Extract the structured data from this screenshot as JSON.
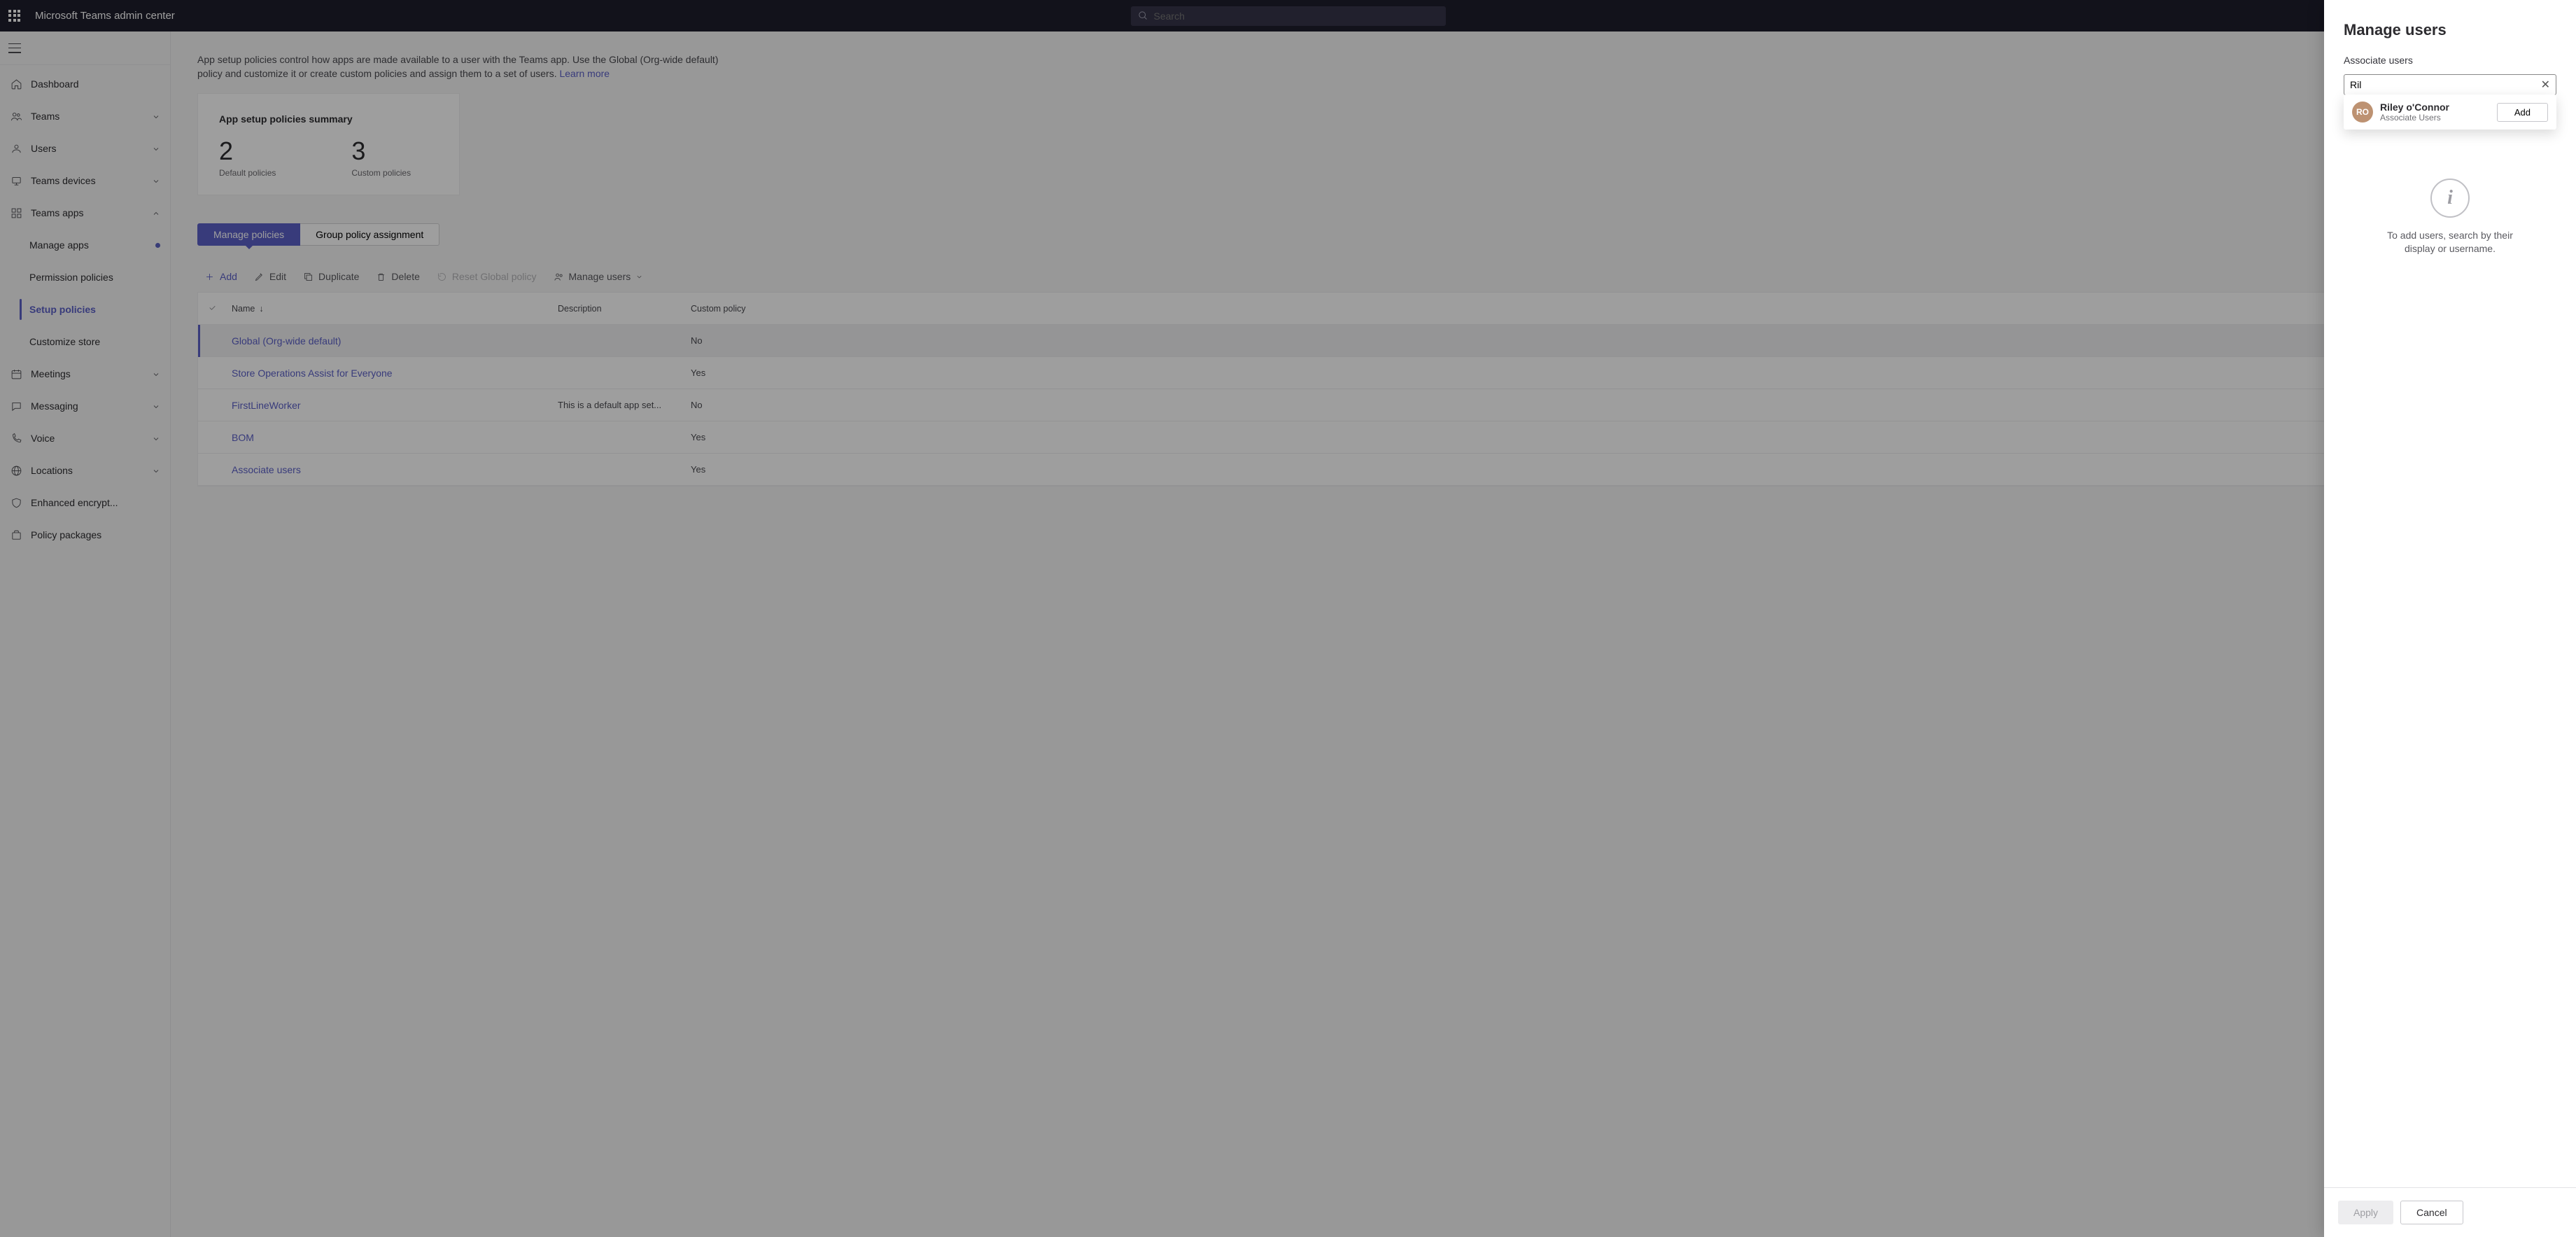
{
  "app_title": "Microsoft Teams admin center",
  "search_placeholder": "Search",
  "nav": {
    "dashboard": "Dashboard",
    "teams": "Teams",
    "users": "Users",
    "teams_devices": "Teams devices",
    "teams_apps": "Teams apps",
    "manage_apps": "Manage apps",
    "permission_policies": "Permission policies",
    "setup_policies": "Setup policies",
    "customize_store": "Customize store",
    "meetings": "Meetings",
    "messaging": "Messaging",
    "voice": "Voice",
    "locations": "Locations",
    "enhanced_encrypt": "Enhanced encrypt...",
    "policy_packages": "Policy packages"
  },
  "page": {
    "desc": "App setup policies control how apps are made available to a user with the Teams app. Use the Global (Org-wide default) policy and customize it or create custom policies and assign them to a set of users. ",
    "learn_more": "Learn more",
    "summary_title": "App setup policies summary",
    "default_count": "2",
    "default_label": "Default policies",
    "custom_count": "3",
    "custom_label": "Custom policies"
  },
  "tabs": {
    "manage": "Manage policies",
    "group": "Group policy assignment"
  },
  "toolbar": {
    "add": "Add",
    "edit": "Edit",
    "duplicate": "Duplicate",
    "delete": "Delete",
    "reset": "Reset Global policy",
    "manage_users": "Manage users"
  },
  "cols": {
    "name": "Name",
    "desc": "Description",
    "custom": "Custom policy"
  },
  "rows": [
    {
      "name": "Global (Org-wide default)",
      "desc": "",
      "custom": "No"
    },
    {
      "name": "Store Operations Assist for Everyone",
      "desc": "",
      "custom": "Yes"
    },
    {
      "name": "FirstLineWorker",
      "desc": "This is a default app set...",
      "custom": "No"
    },
    {
      "name": "BOM",
      "desc": "",
      "custom": "Yes"
    },
    {
      "name": "Associate users",
      "desc": "",
      "custom": "Yes"
    }
  ],
  "panel": {
    "title": "Manage users",
    "subtitle": "Associate users",
    "search_value": "Ril",
    "result_initials": "RO",
    "result_name": "Riley o'Connor",
    "result_sub": "Associate Users",
    "add_btn": "Add",
    "info_text": "To add users, search by their display or username.",
    "apply": "Apply",
    "cancel": "Cancel"
  }
}
